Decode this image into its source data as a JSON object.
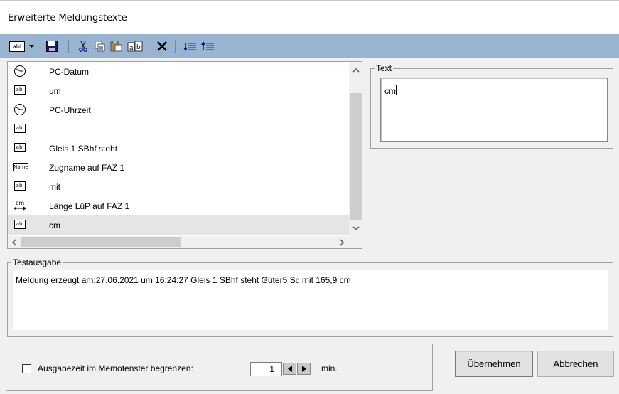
{
  "window": {
    "title": "Erweiterte Meldungstexte"
  },
  "toolbar": {
    "buttons": [
      {
        "icon": "text-field-icon",
        "label": "abl"
      },
      {
        "icon": "dropdown-arrow-icon"
      },
      {
        "icon": "save-icon"
      },
      {
        "icon": "cut-icon"
      },
      {
        "icon": "copy-icon"
      },
      {
        "icon": "paste-icon"
      },
      {
        "icon": "paste-special-icon"
      },
      {
        "icon": "delete-icon"
      },
      {
        "icon": "move-down-icon"
      },
      {
        "icon": "move-up-icon"
      }
    ]
  },
  "list": {
    "items": [
      {
        "icon": "clock-icon",
        "label": "PC-Datum"
      },
      {
        "icon": "text-field-icon",
        "label": "um"
      },
      {
        "icon": "clock-icon",
        "label": "PC-Uhrzeit"
      },
      {
        "icon": "text-field-icon",
        "label": ""
      },
      {
        "icon": "text-field-icon",
        "label": "Gleis 1 SBhf steht"
      },
      {
        "icon": "name-tag-icon",
        "label": "Zugname auf FAZ 1"
      },
      {
        "icon": "text-field-icon",
        "label": "mit"
      },
      {
        "icon": "length-measure-icon",
        "label": "Länge LüP auf FAZ 1"
      },
      {
        "icon": "text-field-icon",
        "label": "cm"
      }
    ],
    "selected_index": 8,
    "icon_text": {
      "abl": "abl",
      "name": "Name",
      "cm": "cm"
    }
  },
  "text_group": {
    "legend": "Text",
    "value": "cm"
  },
  "output_group": {
    "legend": "Testausgabe",
    "value": "Meldung erzeugt am:27.06.2021 um 16:24:27 Gleis 1 SBhf steht Güter5 Sc mit 165,9 cm"
  },
  "bottom": {
    "checkbox_label": "Ausgabezeit im Memofenster begrenzen:",
    "checkbox_checked": false,
    "spin_value": "1",
    "unit": "min."
  },
  "buttons": {
    "apply": "Übernehmen",
    "cancel": "Abbrechen"
  },
  "colors": {
    "toolbar": "#99b4d1",
    "selection": "#e5e5e5",
    "background": "#f0f0f0"
  }
}
